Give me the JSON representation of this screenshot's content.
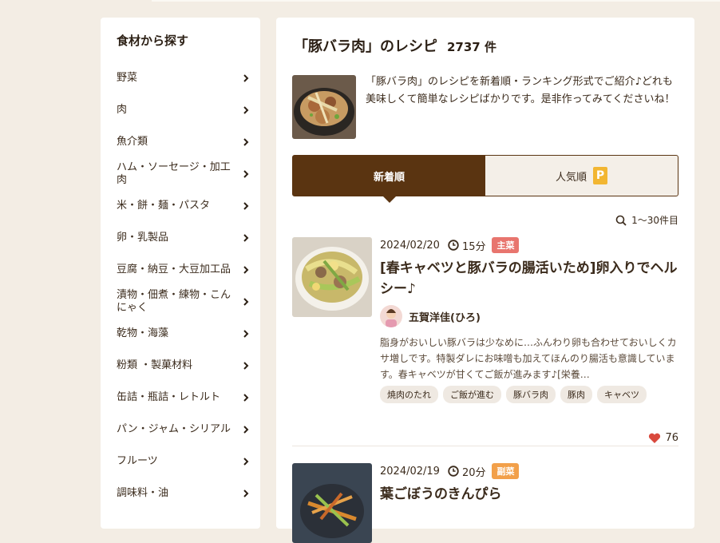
{
  "sidebar": {
    "title": "食材から探す",
    "items": [
      {
        "label": "野菜"
      },
      {
        "label": "肉"
      },
      {
        "label": "魚介類"
      },
      {
        "label": "ハム・ソーセージ・加工肉"
      },
      {
        "label": "米・餅・麺・パスタ"
      },
      {
        "label": "卵・乳製品"
      },
      {
        "label": "豆腐・納豆・大豆加工品"
      },
      {
        "label": "漬物・佃煮・練物・こんにゃく"
      },
      {
        "label": "乾物・海藻"
      },
      {
        "label": "粉類 ・製菓材料"
      },
      {
        "label": "缶詰・瓶詰・レトルト"
      },
      {
        "label": "パン・ジャム・シリアル"
      },
      {
        "label": "フルーツ"
      },
      {
        "label": "調味料・油"
      }
    ]
  },
  "main": {
    "title": "「豚バラ肉」のレシピ",
    "count": "2737 件",
    "intro": "「豚バラ肉」のレシピを新着順・ランキング形式でご紹介♪どれも美味しくて簡単なレシピばかりです。是非作ってみてくださいね！",
    "tabs": [
      {
        "label": "新着順"
      },
      {
        "label": "人気順",
        "badge": "P"
      }
    ],
    "result_range": "1〜30件目"
  },
  "recipes": [
    {
      "date": "2024/02/20",
      "time": "15分",
      "category": "主菜",
      "category_color": "#e8756e",
      "title": "[春キャベツと豚バラの腸活いため]卵入りでヘルシー♪",
      "author": "五賀洋佳(ひろ)",
      "description": "脂身がおいしい豚バラは少なめに…ふんわり卵も合わせておいしくカサ増しです。特製ダレにお味噌も加えてほんのり腸活も意識しています。春キャベツが甘くてご飯が進みます♪[栄養…",
      "tags": [
        "焼肉のたれ",
        "ご飯が進む",
        "豚バラ肉",
        "豚肉",
        "キャベツ"
      ],
      "likes": "76"
    },
    {
      "date": "2024/02/19",
      "time": "20分",
      "category": "副菜",
      "category_color": "#f2a04a",
      "title": "葉ごぼうのきんぴら"
    }
  ],
  "colors": {
    "brown": "#5a3411",
    "heart": "#d9493d",
    "badge_p": "#f2b632"
  }
}
